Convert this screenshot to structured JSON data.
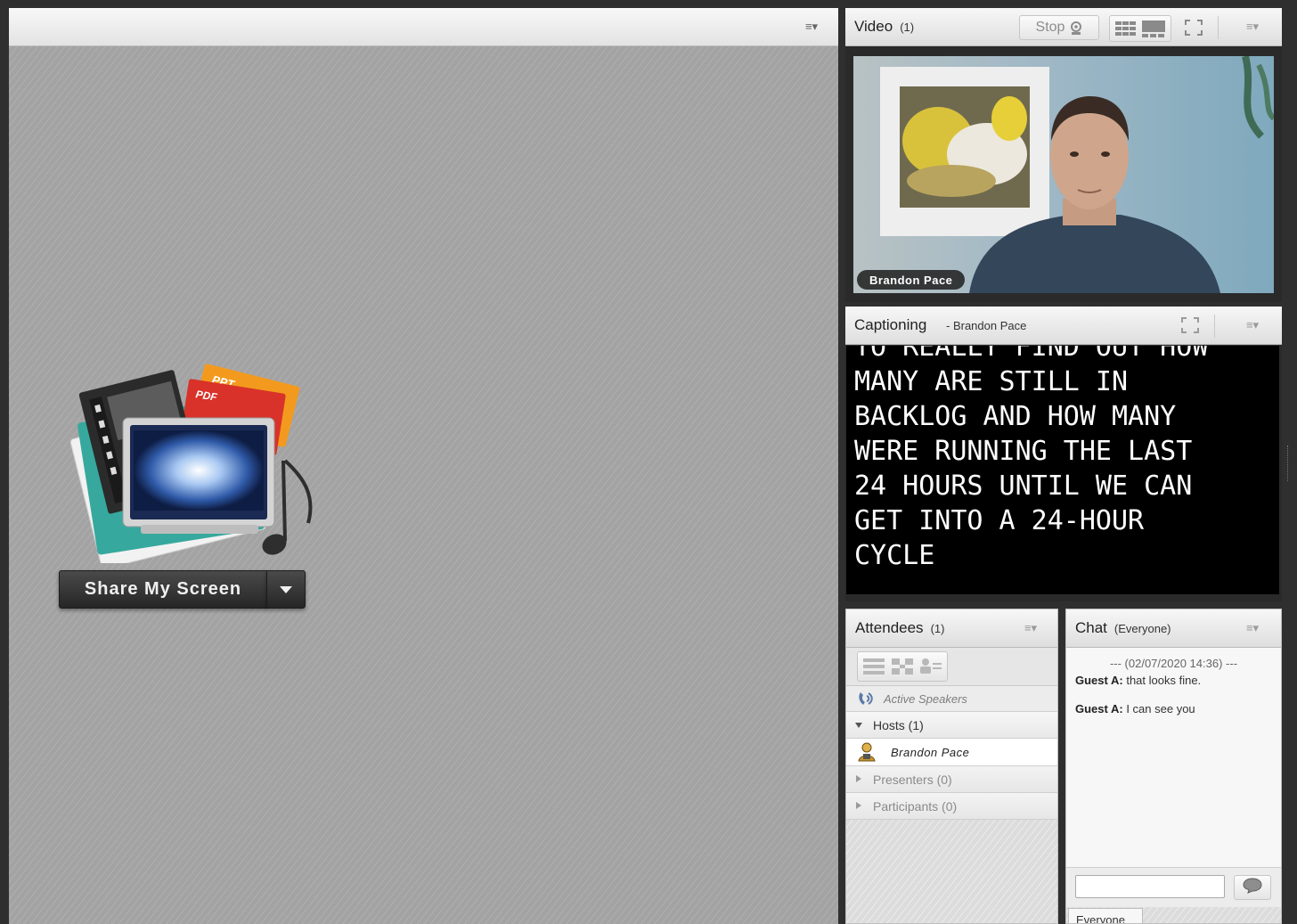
{
  "share_pod": {
    "share_label": "Share My Screen",
    "doc_labels": [
      "PPT",
      "PDF"
    ]
  },
  "video_pod": {
    "title": "Video",
    "count": "(1)",
    "stop_label": "Stop",
    "person_name": "Brandon Pace"
  },
  "captioning_pod": {
    "title": "Captioning",
    "subtitle": "- Brandon Pace",
    "lines": [
      "TO REALLY FIND OUT HOW",
      "MANY ARE STILL IN",
      "BACKLOG AND HOW MANY",
      "WERE RUNNING THE LAST",
      "24 HOURS UNTIL WE CAN",
      "GET INTO A 24-HOUR",
      "CYCLE"
    ]
  },
  "attendees_pod": {
    "title": "Attendees",
    "count": "(1)",
    "active_speakers": "Active Speakers",
    "groups": {
      "hosts": "Hosts (1)",
      "host_name": "Brandon Pace",
      "presenters": "Presenters (0)",
      "participants": "Participants (0)"
    }
  },
  "chat_pod": {
    "title": "Chat",
    "scope": "(Everyone)",
    "timestamp": "--- (02/07/2020 14:36) ---",
    "messages": [
      {
        "sender": "Guest A:",
        "text": "that looks fine."
      },
      {
        "sender": "Guest A:",
        "text": "I can see you"
      }
    ],
    "input_value": "",
    "tab_label": "Everyone"
  },
  "colors": {
    "frame": "#2f2f2f",
    "stage": "#a3a3a3",
    "caption_bg": "#000000",
    "caption_text": "#ffffff"
  }
}
